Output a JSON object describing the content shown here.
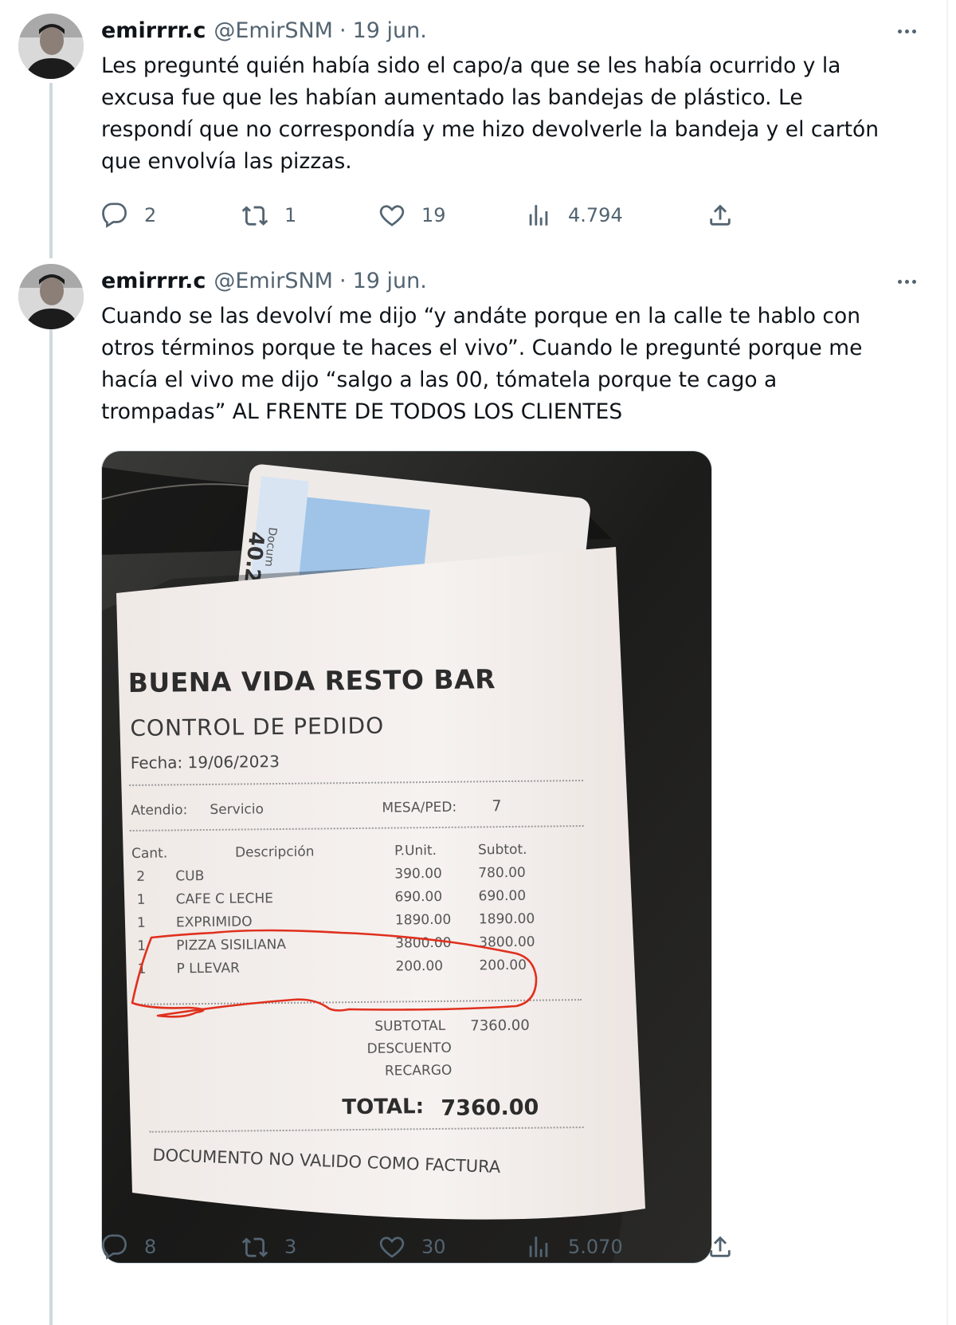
{
  "tweets": [
    {
      "name": "emirrrr.c",
      "handle": "@EmirSNM",
      "separator": "·",
      "date": "19 jun.",
      "text": "Les pregunté quién había sido el capo/a que se les había ocurrido y la\nexcusa fue que les habían aumentado las bandejas de plástico. Le\nrespondí que no correspondía y me hizo devolverle la bandeja y el cartón\nque envolvía las pizzas.",
      "replies": "2",
      "retweets": "1",
      "likes": "19",
      "views": "4.794"
    },
    {
      "name": "emirrrr.c",
      "handle": "@EmirSNM",
      "separator": "·",
      "date": "19 jun.",
      "text": "Cuando se las devolví me dijo “y andáte porque en la calle te hablo con\notros términos porque te haces el vivo”. Cuando le pregunté porque me\nhacía el vivo me dijo “salgo a las 00, tómatela porque te cago a\ntrompadas” AL FRENTE DE TODOS LOS CLIENTES",
      "replies": "8",
      "retweets": "3",
      "likes": "30",
      "views": "5.070"
    }
  ],
  "receipt": {
    "card_number": "40.2",
    "card_label": "Docum",
    "title": "BUENA VIDA RESTO BAR",
    "subtitle": "CONTROL DE PEDIDO",
    "date_line": "Fecha: 19/06/2023",
    "attended_label": "Atendio:",
    "attended_value": "Servicio",
    "table_label": "MESA/PED:",
    "table_value": "7",
    "headers": [
      "Cant.",
      "Descripción",
      "P.Unit.",
      "Subtot."
    ],
    "rows": [
      [
        "2",
        "CUB",
        "390.00",
        "780.00"
      ],
      [
        "1",
        "CAFE C LECHE",
        "690.00",
        "690.00"
      ],
      [
        "1",
        "EXPRIMIDO",
        "1890.00",
        "1890.00"
      ],
      [
        "1",
        "PIZZA SISILIANA",
        "3800.00",
        "3800.00"
      ],
      [
        "1",
        "P LLEVAR",
        "200.00",
        "200.00"
      ]
    ],
    "subtotal_label": "SUBTOTAL",
    "subtotal_value": "7360.00",
    "discount_label": "DESCUENTO",
    "surcharge_label": "RECARGO",
    "total_label": "TOTAL:",
    "total_value": "7360.00",
    "footer": "DOCUMENTO NO VALIDO COMO FACTURA"
  },
  "colors": {
    "text": "#0f1419",
    "secondary": "#536471",
    "thread_line": "#cfd9de",
    "annotation": "#e0301e"
  },
  "icons": [
    "reply-icon",
    "retweet-icon",
    "like-icon",
    "views-icon",
    "share-icon",
    "more-icon"
  ]
}
